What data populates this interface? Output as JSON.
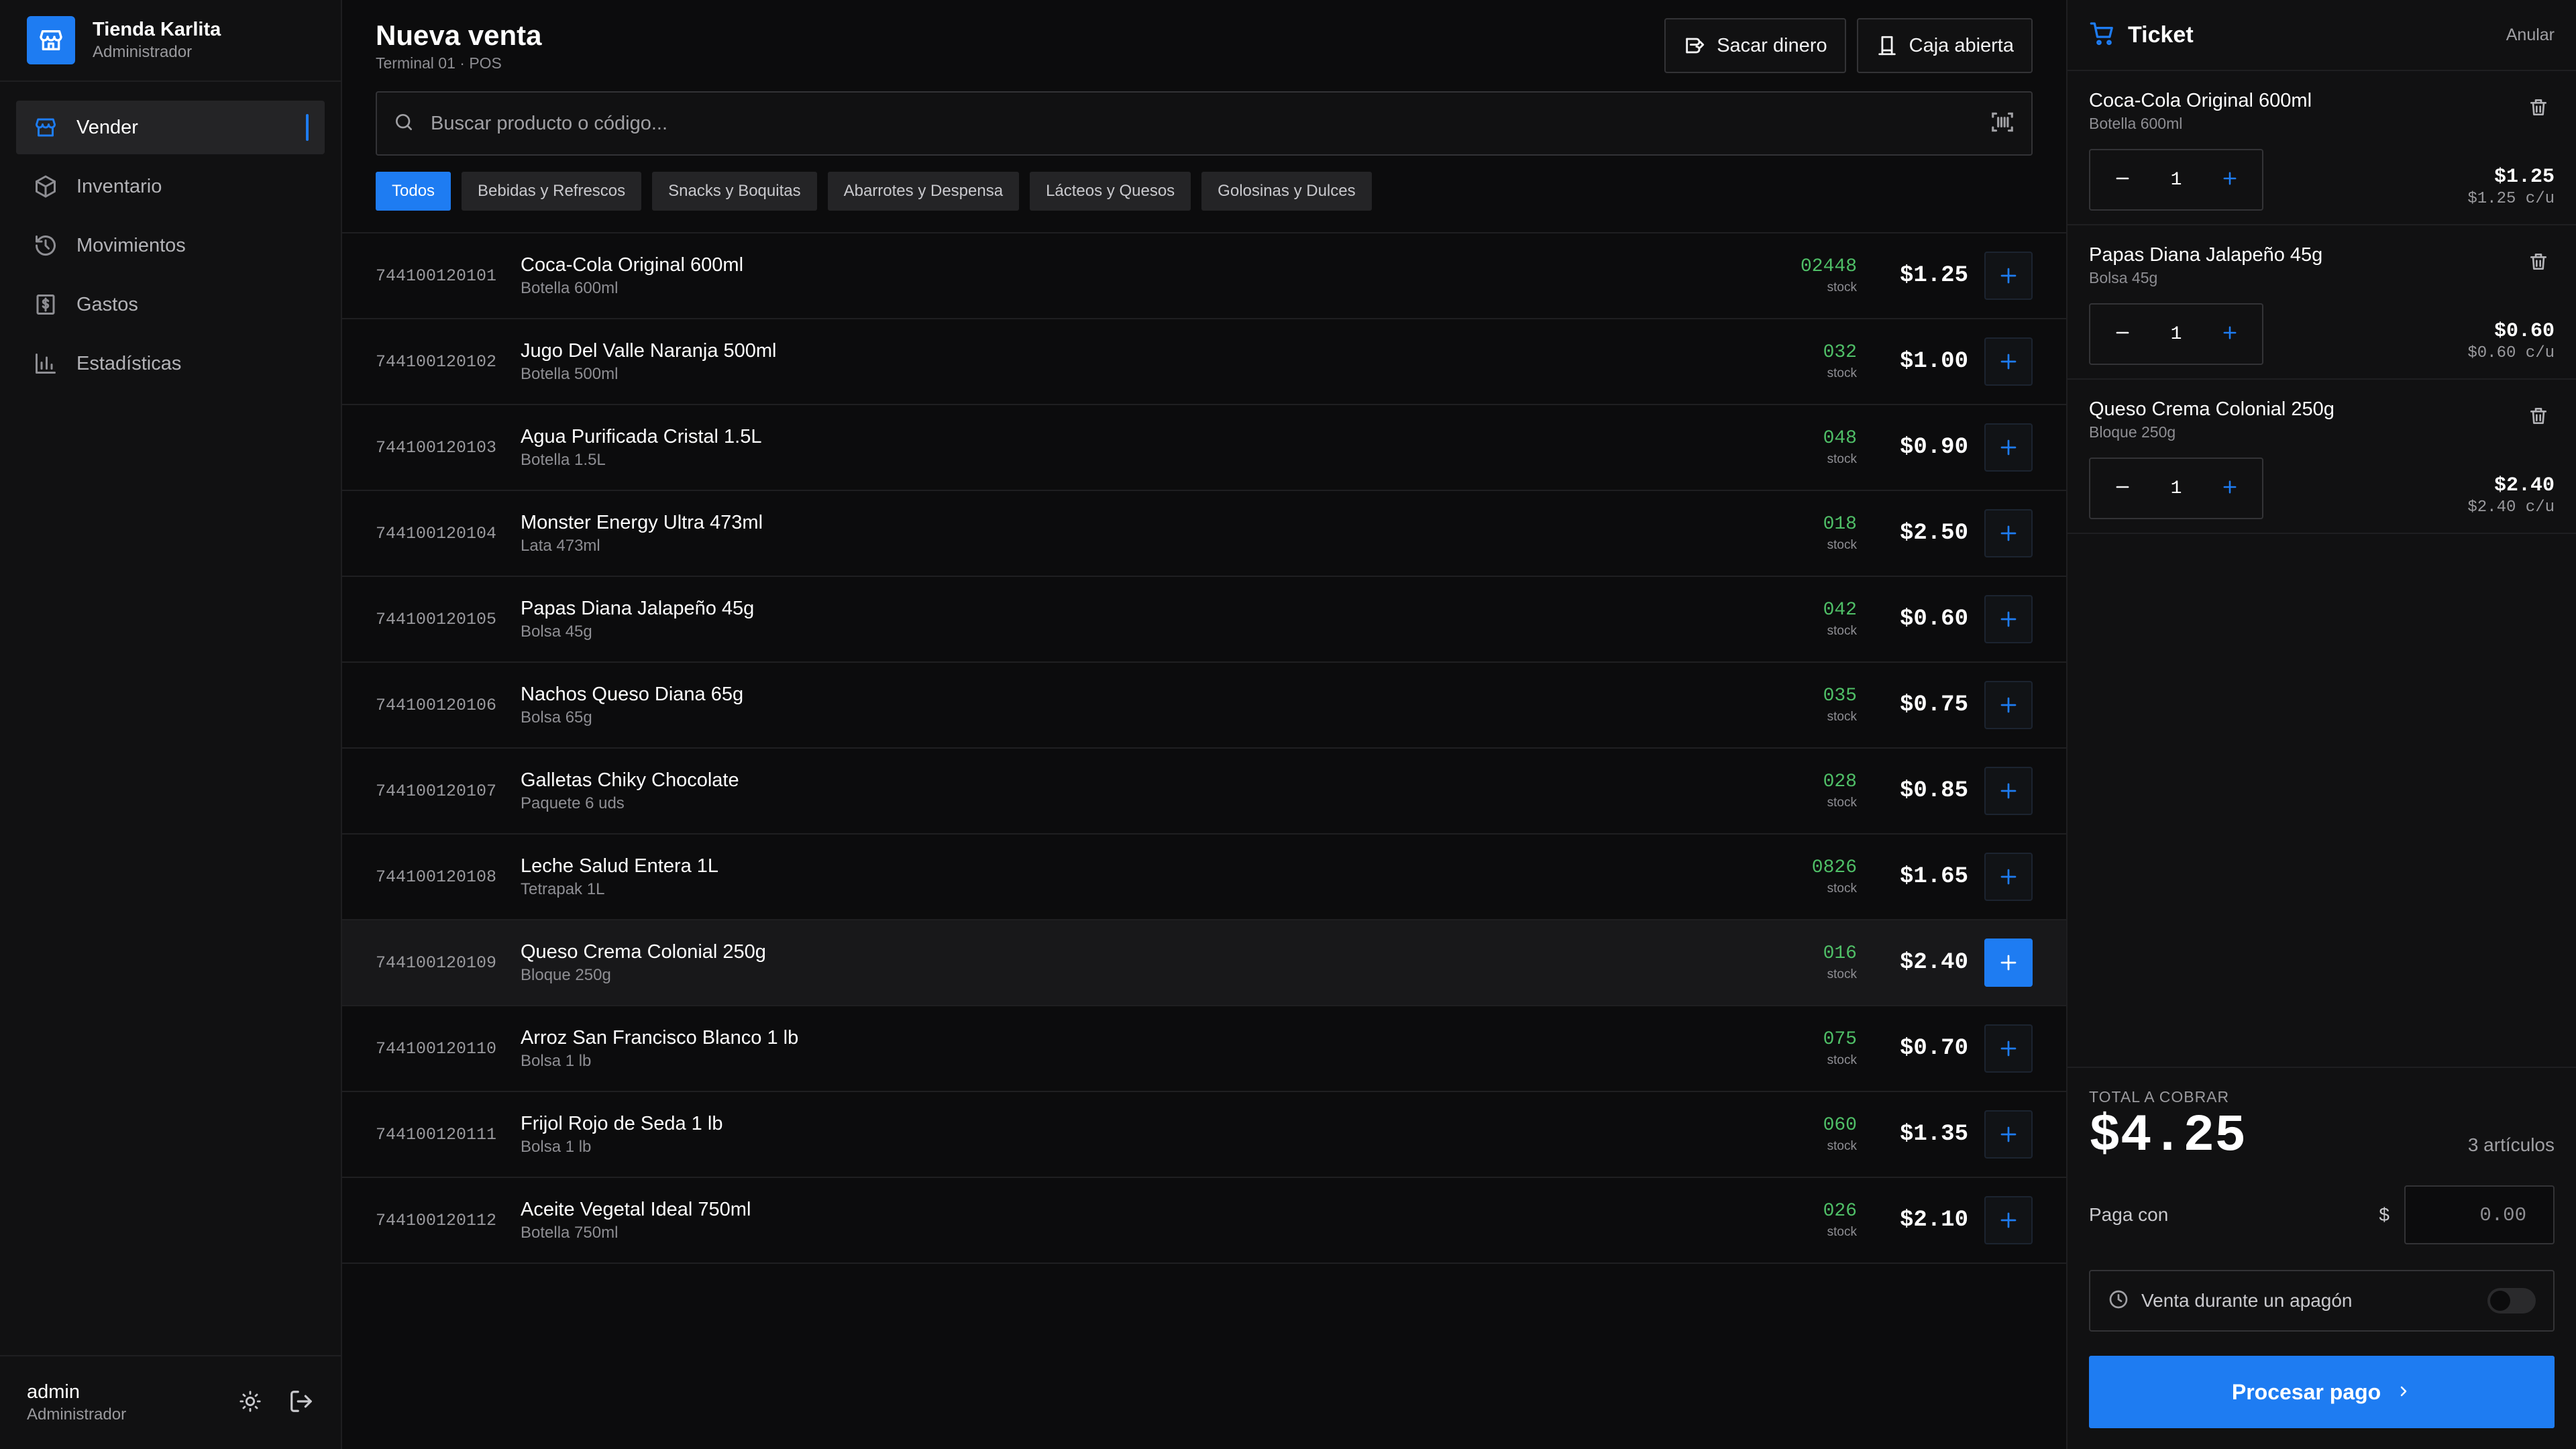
{
  "brand": {
    "name": "Tienda Karlita",
    "role": "Administrador",
    "icon": "store-icon"
  },
  "nav": [
    {
      "label": "Vender",
      "icon": "store-icon",
      "active": true
    },
    {
      "label": "Inventario",
      "icon": "box-icon"
    },
    {
      "label": "Movimientos",
      "icon": "history-icon"
    },
    {
      "label": "Gastos",
      "icon": "dollar-receipt-icon"
    },
    {
      "label": "Estadísticas",
      "icon": "bar-chart-icon"
    }
  ],
  "user": {
    "name": "admin",
    "role": "Administrador"
  },
  "header": {
    "title": "Nueva venta",
    "subtitle": "Terminal 01 · POS",
    "withdraw_label": "Sacar dinero",
    "register_label": "Caja abierta"
  },
  "search": {
    "placeholder": "Buscar producto o código..."
  },
  "categories": [
    {
      "label": "Todos",
      "active": true
    },
    {
      "label": "Bebidas y Refrescos"
    },
    {
      "label": "Snacks y Boquitas"
    },
    {
      "label": "Abarrotes y Despensa"
    },
    {
      "label": "Lácteos y Quesos"
    },
    {
      "label": "Golosinas y Dulces"
    }
  ],
  "products": [
    {
      "code": "744100120101",
      "name": "Coca-Cola Original 600ml",
      "desc": "Botella 600ml",
      "stock": "02448",
      "stock_label": "stock",
      "price": "$1.25"
    },
    {
      "code": "744100120102",
      "name": "Jugo Del Valle Naranja 500ml",
      "desc": "Botella 500ml",
      "stock": "032",
      "stock_label": "stock",
      "price": "$1.00"
    },
    {
      "code": "744100120103",
      "name": "Agua Purificada Cristal 1.5L",
      "desc": "Botella 1.5L",
      "stock": "048",
      "stock_label": "stock",
      "price": "$0.90"
    },
    {
      "code": "744100120104",
      "name": "Monster Energy Ultra 473ml",
      "desc": "Lata 473ml",
      "stock": "018",
      "stock_label": "stock",
      "price": "$2.50"
    },
    {
      "code": "744100120105",
      "name": "Papas Diana Jalapeño 45g",
      "desc": "Bolsa 45g",
      "stock": "042",
      "stock_label": "stock",
      "price": "$0.60"
    },
    {
      "code": "744100120106",
      "name": "Nachos Queso Diana 65g",
      "desc": "Bolsa 65g",
      "stock": "035",
      "stock_label": "stock",
      "price": "$0.75"
    },
    {
      "code": "744100120107",
      "name": "Galletas Chiky Chocolate",
      "desc": "Paquete 6 uds",
      "stock": "028",
      "stock_label": "stock",
      "price": "$0.85"
    },
    {
      "code": "744100120108",
      "name": "Leche Salud Entera 1L",
      "desc": "Tetrapak 1L",
      "stock": "0826",
      "stock_label": "stock",
      "price": "$1.65"
    },
    {
      "code": "744100120109",
      "name": "Queso Crema Colonial 250g",
      "desc": "Bloque 250g",
      "stock": "016",
      "stock_label": "stock",
      "price": "$2.40",
      "highlighted": true
    },
    {
      "code": "744100120110",
      "name": "Arroz San Francisco Blanco 1 lb",
      "desc": "Bolsa 1 lb",
      "stock": "075",
      "stock_label": "stock",
      "price": "$0.70"
    },
    {
      "code": "744100120111",
      "name": "Frijol Rojo de Seda 1 lb",
      "desc": "Bolsa 1 lb",
      "stock": "060",
      "stock_label": "stock",
      "price": "$1.35"
    },
    {
      "code": "744100120112",
      "name": "Aceite Vegetal Ideal 750ml",
      "desc": "Botella 750ml",
      "stock": "026",
      "stock_label": "stock",
      "price": "$2.10"
    }
  ],
  "ticket": {
    "title": "Ticket",
    "void_label": "Anular",
    "items": [
      {
        "name": "Coca-Cola Original 600ml",
        "desc": "Botella 600ml",
        "qty": "1",
        "total": "$1.25",
        "unit": "$1.25 c/u"
      },
      {
        "name": "Papas Diana Jalapeño 45g",
        "desc": "Bolsa 45g",
        "qty": "1",
        "total": "$0.60",
        "unit": "$0.60 c/u"
      },
      {
        "name": "Queso Crema Colonial 250g",
        "desc": "Bloque 250g",
        "qty": "1",
        "total": "$2.40",
        "unit": "$2.40 c/u"
      }
    ],
    "total_label": "TOTAL A COBRAR",
    "total": "$4.25",
    "count": "3 artículos",
    "pay_label": "Paga con",
    "currency": "$",
    "pay_placeholder": "0.00",
    "blackout_label": "Venta durante un apagón",
    "blackout_on": false,
    "process_label": "Procesar pago"
  },
  "colors": {
    "accent": "#1e7cf2",
    "stock": "#4fbf67",
    "background": "#0c0c0d",
    "panel": "#111112"
  }
}
